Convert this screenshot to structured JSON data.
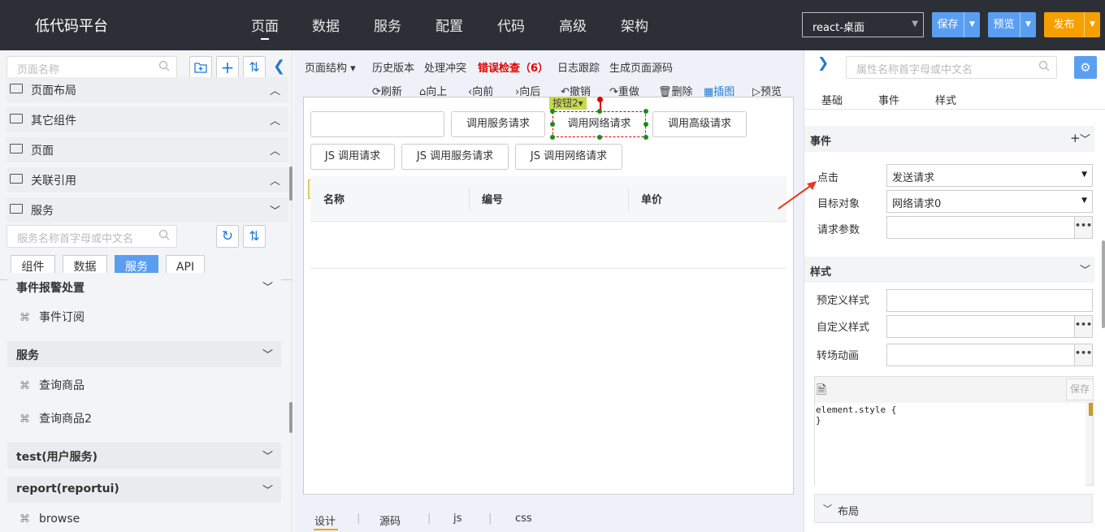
{
  "header": {
    "app_title": "低代码平台",
    "nav": [
      "页面",
      "数据",
      "服务",
      "配置",
      "代码",
      "高级",
      "架构"
    ],
    "env_select": "react-桌面",
    "save": "保存",
    "preview": "预览",
    "publish": "发布",
    "colors": {
      "bg": "#2c3036",
      "save": "#5a9ef2",
      "preview": "#5a9ef2",
      "publish": "#f5a000"
    }
  },
  "left": {
    "page_search_placeholder": "页面名称",
    "sections": [
      "页面布局",
      "其它组件",
      "页面",
      "关联引用",
      "服务"
    ],
    "service_search_placeholder": "服务名称首字母或中文名",
    "tabs": [
      "组件",
      "数据",
      "服务",
      "API"
    ],
    "active_tab": "服务",
    "groups": [
      {
        "title": "事件报警处置",
        "items": [
          "事件订阅"
        ]
      },
      {
        "title": "服务",
        "items": [
          "查询商品",
          "查询商品2"
        ]
      },
      {
        "title": "test(用户服务)",
        "items": []
      },
      {
        "title": "report(reportui)",
        "items": [
          "browse"
        ]
      }
    ]
  },
  "center": {
    "toolbar": [
      "页面结构",
      "历史版本",
      "处理冲突",
      "错误检查（6）",
      "日志跟踪",
      "生成页面源码"
    ],
    "error_color": "#e00000",
    "actions": [
      "刷新",
      "向上",
      "向前",
      "向后",
      "撤销",
      "重做",
      "删除",
      "插图",
      "预览"
    ],
    "selected_tag": "按钮2",
    "buttons_row1": [
      "调用服务请求",
      "调用网络请求",
      "调用高级请求"
    ],
    "buttons_row2": [
      "JS 调用请求",
      "JS 调用服务请求",
      "JS 调用网络请求"
    ],
    "table_headers": [
      "名称",
      "编号",
      "单价"
    ],
    "bottom_tabs": [
      "设计",
      "源码",
      "js",
      "css"
    ]
  },
  "right": {
    "search_placeholder": "属性名称首字母或中文名",
    "tabs": [
      "基础",
      "事件",
      "样式"
    ],
    "events_title": "事件",
    "events_add": "+",
    "click_label": "点击",
    "click_value": "发送请求",
    "target_label": "目标对象",
    "target_value": "网络请求0",
    "params_label": "请求参数",
    "style_title": "样式",
    "predefined_label": "预定义样式",
    "custom_label": "自定义样式",
    "transition_label": "转场动画",
    "code_save": "保存",
    "code_line1": "element.style {",
    "code_line2": "}",
    "layout_label": "布局",
    "more": "•••"
  }
}
